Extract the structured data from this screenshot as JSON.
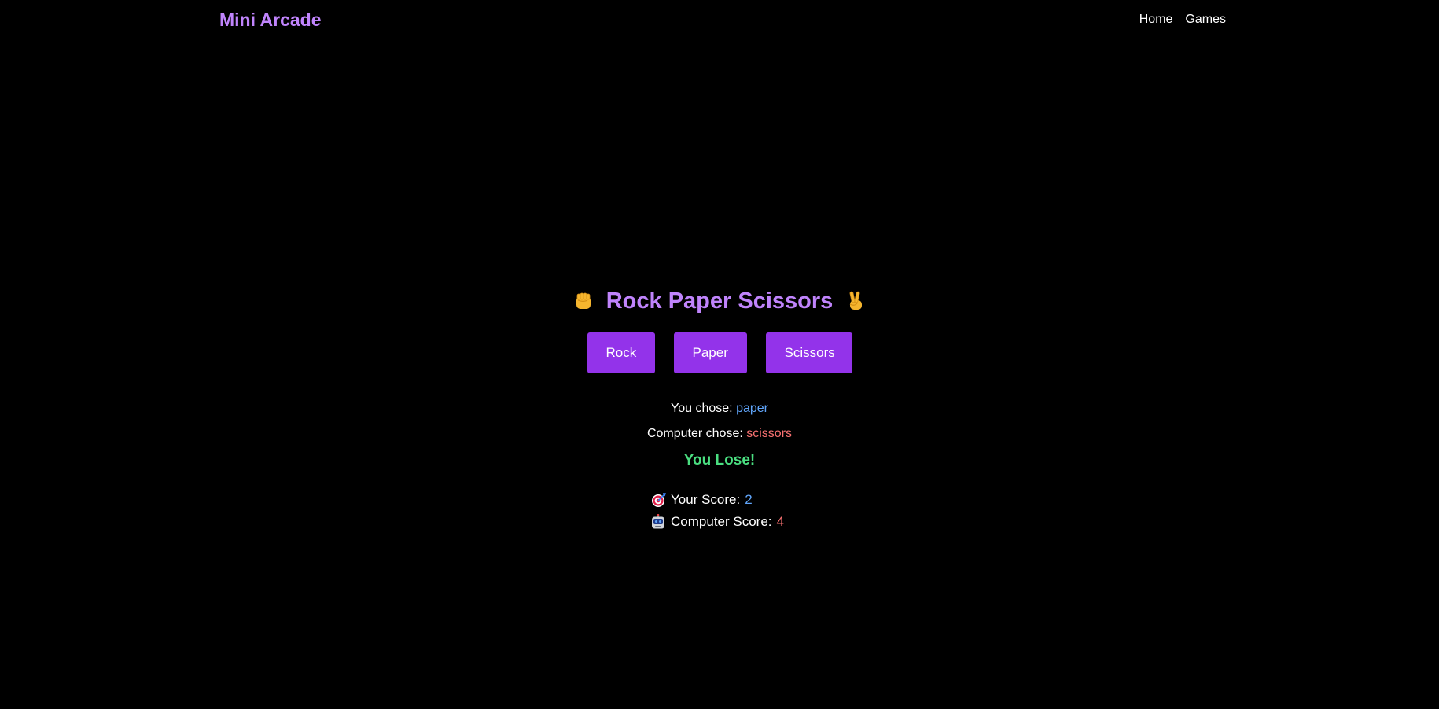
{
  "nav": {
    "brand": "Mini Arcade",
    "links": [
      "Home",
      "Games"
    ]
  },
  "game": {
    "title": "Rock Paper Scissors",
    "title_left_icon": "raised-fist-icon",
    "title_right_icon": "victory-hand-icon",
    "buttons": [
      "Rock",
      "Paper",
      "Scissors"
    ],
    "you_chose_label": "You chose:",
    "you_chose_value": "paper",
    "computer_chose_label": "Computer chose:",
    "computer_chose_value": "scissors",
    "outcome": "You Lose!",
    "your_score_label": "Your Score:",
    "your_score_value": "2",
    "your_score_icon": "target-icon",
    "computer_score_label": "Computer Score:",
    "computer_score_value": "4",
    "computer_score_icon": "robot-icon"
  },
  "colors": {
    "background": "#000000",
    "accent": "#c084fc",
    "button": "#9333ea",
    "blue": "#60a5fa",
    "red": "#f87171",
    "green": "#4ade80"
  }
}
